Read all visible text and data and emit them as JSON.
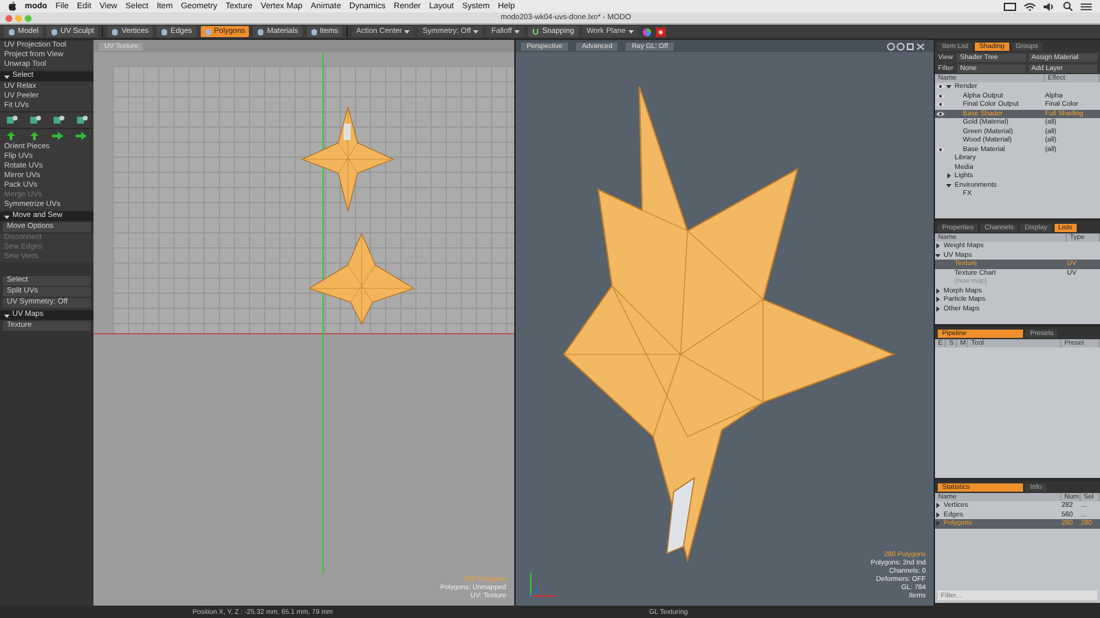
{
  "menubar": {
    "app": "modo",
    "menus": [
      "File",
      "Edit",
      "View",
      "Select",
      "Item",
      "Geometry",
      "Texture",
      "Vertex Map",
      "Animate",
      "Dynamics",
      "Render",
      "Layout",
      "System",
      "Help"
    ]
  },
  "window": {
    "title": "modo203-wk04-uvs-done.lxo* - MODO"
  },
  "toolbar": {
    "modes": [
      {
        "label": "Model",
        "selected": false
      },
      {
        "label": "UV Sculpt",
        "selected": false
      }
    ],
    "components": [
      {
        "label": "Vertices",
        "selected": false
      },
      {
        "label": "Edges",
        "selected": false
      },
      {
        "label": "Polygons",
        "selected": true
      },
      {
        "label": "Materials",
        "selected": false
      },
      {
        "label": "Items",
        "selected": false
      }
    ],
    "dropdowns": [
      "Action Center",
      "Symmetry: Off",
      "Falloff"
    ],
    "snapping": "Snapping",
    "workplane": "Work Plane"
  },
  "left_panel": [
    {
      "kind": "item",
      "label": "UV Projection Tool",
      "disabled": false
    },
    {
      "kind": "item",
      "label": "Project from View",
      "disabled": false
    },
    {
      "kind": "item",
      "label": "Unwrap Tool",
      "disabled": false
    },
    {
      "kind": "header",
      "label": "Select"
    },
    {
      "kind": "item",
      "label": "UV Relax",
      "disabled": false
    },
    {
      "kind": "item",
      "label": "UV Peeler",
      "disabled": false
    },
    {
      "kind": "item",
      "label": "Fit UVs",
      "disabled": false
    },
    {
      "kind": "icons"
    },
    {
      "kind": "item",
      "label": "Orient Pieces",
      "disabled": false
    },
    {
      "kind": "item",
      "label": "Flip UVs",
      "disabled": false
    },
    {
      "kind": "item",
      "label": "Rotate UVs",
      "disabled": false
    },
    {
      "kind": "item",
      "label": "Mirror UVs",
      "disabled": false
    },
    {
      "kind": "item",
      "label": "Pack UVs",
      "disabled": false
    },
    {
      "kind": "item",
      "label": "Merge UVs",
      "disabled": true
    },
    {
      "kind": "item",
      "label": "Symmetrize UVs",
      "disabled": false
    },
    {
      "kind": "header",
      "label": "Move and Sew"
    },
    {
      "kind": "dropdown",
      "label": "Move Options"
    },
    {
      "kind": "item",
      "label": "Disconnect",
      "disabled": true
    },
    {
      "kind": "item",
      "label": "Sew Edges",
      "disabled": true
    },
    {
      "kind": "item",
      "label": "Sew Verts",
      "disabled": true
    },
    {
      "kind": "gap"
    },
    {
      "kind": "dropdown",
      "label": "Select"
    },
    {
      "kind": "dropdown",
      "label": "Split UVs"
    },
    {
      "kind": "dropdown",
      "label": "UV Symmetry: Off"
    },
    {
      "kind": "header",
      "label": "UV Maps"
    },
    {
      "kind": "dropdown",
      "label": "Texture"
    }
  ],
  "uv_view": {
    "tab": "UV Texture",
    "info": [
      {
        "text": "280 Polygons",
        "highlight": true
      },
      {
        "text": "Polygons: Unmapped",
        "highlight": false
      },
      {
        "text": "UV: Texture",
        "highlight": false
      }
    ]
  },
  "persp_view": {
    "tabs": [
      "Perspective",
      "Advanced",
      "Ray GL: Off"
    ],
    "info": [
      {
        "text": "280 Polygons",
        "highlight": true
      },
      {
        "text": "Polygons: 2nd Ind",
        "highlight": false
      },
      {
        "text": "Channels: 0",
        "highlight": false
      },
      {
        "text": "Deformers: OFF",
        "highlight": false
      },
      {
        "text": "GL: 784",
        "highlight": false
      },
      {
        "text": "Items",
        "highlight": false
      }
    ]
  },
  "shading_panel": {
    "tabs": [
      {
        "label": "Item List",
        "selected": false
      },
      {
        "label": "Shading",
        "selected": true
      },
      {
        "label": "Groups",
        "selected": false
      }
    ],
    "view_label": "View",
    "view": "Shader Tree",
    "view_action": "Assign Material",
    "filter_label": "Filter",
    "filter": "None",
    "filter_action": "Add Layer",
    "columns": [
      "Name",
      "Effect"
    ],
    "tree": [
      {
        "name": "Render",
        "visible": true,
        "selected": false,
        "expanded": true,
        "children": [
          {
            "name": "Alpha Output",
            "effect": "Alpha",
            "visible": true,
            "selected": false
          },
          {
            "name": "Final Color Output",
            "effect": "Final Color",
            "visible": true,
            "selected": false
          },
          {
            "name": "Base Shader",
            "effect": "Full Shading",
            "visible": true,
            "selected": true
          },
          {
            "name": "Gold (Material)",
            "effect": "(all)",
            "visible": false,
            "selected": false
          },
          {
            "name": "Green (Material)",
            "effect": "(all)",
            "visible": false,
            "selected": false
          },
          {
            "name": "Wood (Material)",
            "effect": "(all)",
            "visible": false,
            "selected": false
          },
          {
            "name": "Base Material",
            "effect": "(all)",
            "visible": true,
            "selected": false
          }
        ]
      },
      {
        "name": "Library",
        "visible": false,
        "selected": false
      },
      {
        "name": "Media",
        "visible": false,
        "selected": false
      },
      {
        "name": "Lights",
        "visible": false,
        "selected": false,
        "expanded": false
      },
      {
        "name": "Environments",
        "visible": false,
        "selected": false,
        "expanded": true,
        "children": [
          {
            "name": "FX",
            "visible": false,
            "selected": false
          }
        ]
      }
    ]
  },
  "lists_panel": {
    "tabs": [
      {
        "label": "Properties",
        "selected": false
      },
      {
        "label": "Channels",
        "selected": false
      },
      {
        "label": "Display",
        "selected": false
      },
      {
        "label": "Lists",
        "selected": true
      }
    ],
    "columns": [
      "Name",
      "Type"
    ],
    "tree": [
      {
        "name": "Weight Maps",
        "selected": false,
        "disabled": false,
        "expanded": false
      },
      {
        "name": "UV Maps",
        "selected": false,
        "disabled": false,
        "expanded": true,
        "children": [
          {
            "name": "Texture",
            "type": "UV",
            "selected": true,
            "disabled": false
          },
          {
            "name": "Texture Chart",
            "type": "UV",
            "selected": false,
            "disabled": false
          },
          {
            "name": "(new map)",
            "selected": false,
            "disabled": true
          }
        ]
      },
      {
        "name": "Morph Maps",
        "selected": false,
        "disabled": false,
        "expanded": false
      },
      {
        "name": "Particle Maps",
        "selected": false,
        "disabled": false,
        "expanded": false
      },
      {
        "name": "Other Maps",
        "selected": false,
        "disabled": false,
        "expanded": false
      }
    ]
  },
  "pipeline_panel": {
    "tabs": [
      {
        "label": "Pipeline",
        "selected": true
      },
      {
        "label": "Presets",
        "selected": false
      }
    ],
    "columns": [
      "E",
      "S",
      "M",
      "Tool",
      "Preset"
    ]
  },
  "stats_panel": {
    "tabs": [
      {
        "label": "Statistics",
        "selected": true
      },
      {
        "label": "Info",
        "selected": false
      }
    ],
    "columns": [
      "Name",
      "Num",
      "Sel"
    ],
    "rows": [
      {
        "name": "Vertices",
        "num": "282",
        "sel": "...",
        "selected": false
      },
      {
        "name": "Edges",
        "num": "560",
        "sel": "...",
        "selected": false
      },
      {
        "name": "Polygons",
        "num": "280",
        "sel": "280",
        "selected": true
      }
    ],
    "filter_placeholder": "Filter..."
  },
  "status_bar": {
    "position": "Position X, Y, Z :  -25.32 mm, 65.1 mm, 79 mm",
    "mode": "GL Texturing"
  }
}
